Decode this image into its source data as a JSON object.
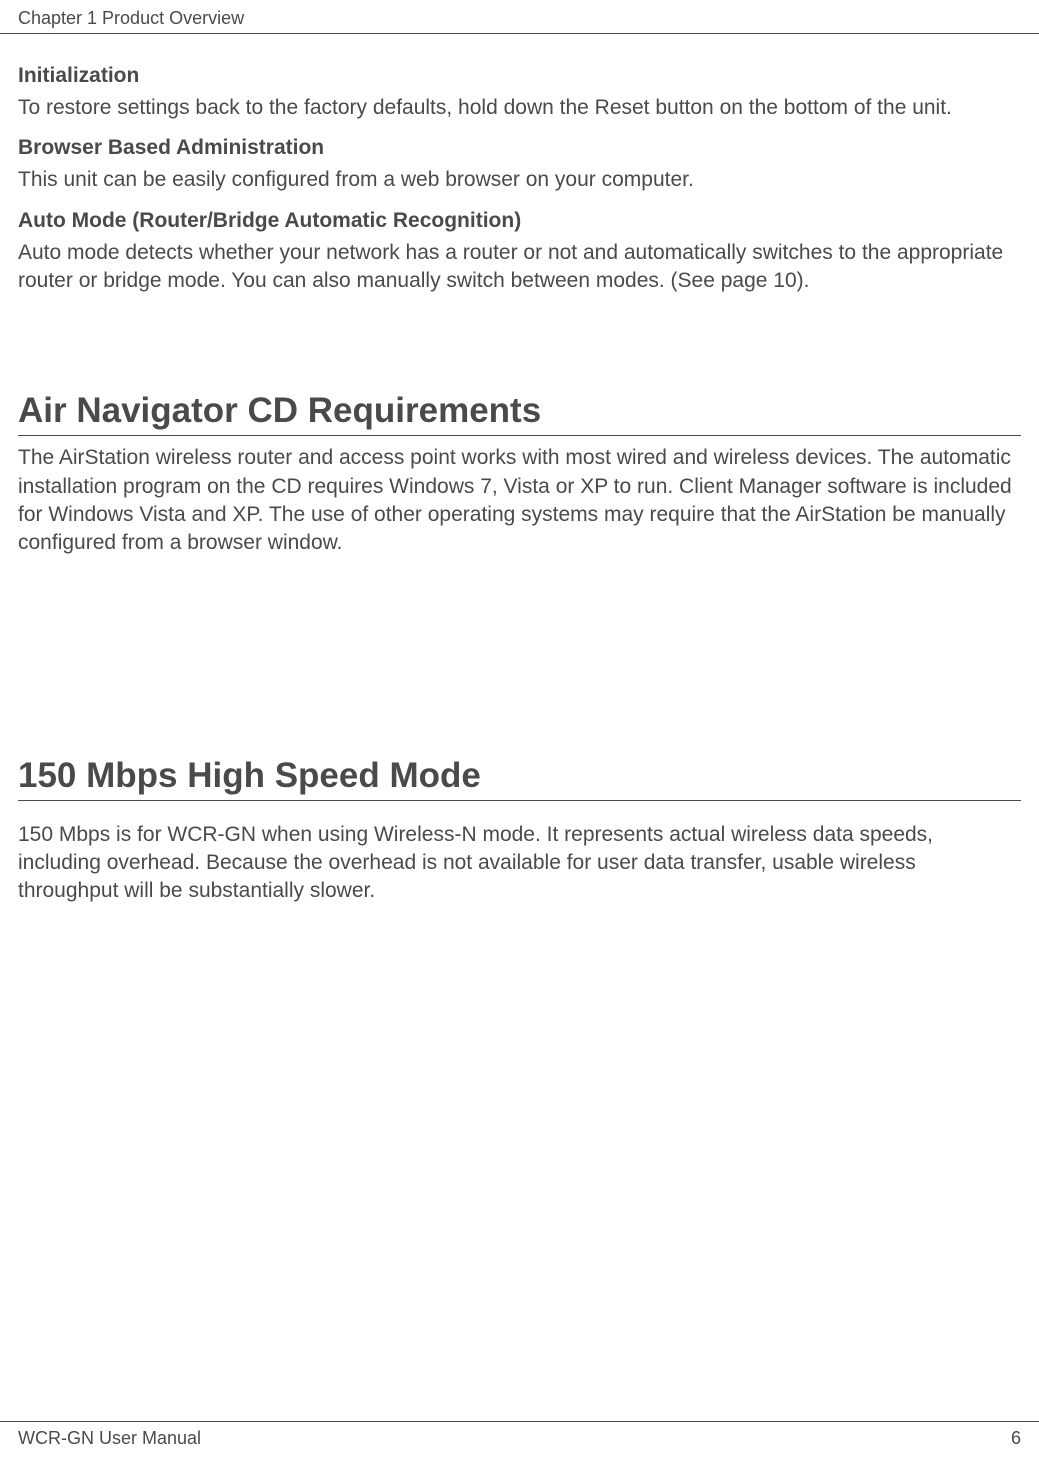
{
  "header": {
    "chapter": "Chapter 1  Product Overview"
  },
  "sections": {
    "initialization": {
      "heading": "Initialization",
      "body": "To restore settings back to the factory defaults, hold down the Reset button on the bottom of the unit."
    },
    "browser_admin": {
      "heading": "Browser Based Administration",
      "body": "This unit can be easily configured from a web browser on your computer."
    },
    "auto_mode": {
      "heading": "Auto Mode (Router/Bridge Automatic Recognition)",
      "body": "Auto mode detects whether your network has a router or not and automatically switches to the appropriate router or bridge mode. You can also manually switch between modes. (See page 10)."
    },
    "air_navigator": {
      "heading": "Air Navigator CD Requirements",
      "body": "The AirStation wireless router and access point works with most wired and wireless devices.  The automatic installation program on the CD requires Windows 7, Vista or XP to run. Client Manager software is included for Windows Vista and XP. The use of other operating systems may require that the AirStation be manually configured from a browser window."
    },
    "high_speed": {
      "heading": "150 Mbps High Speed Mode",
      "body": "150 Mbps is for WCR-GN when using Wireless-N mode. It represents actual wireless data speeds, including overhead. Because the overhead is not available for user data transfer, usable wireless throughput will be substantially slower."
    }
  },
  "footer": {
    "manual": "WCR-GN User Manual",
    "page": "6"
  }
}
